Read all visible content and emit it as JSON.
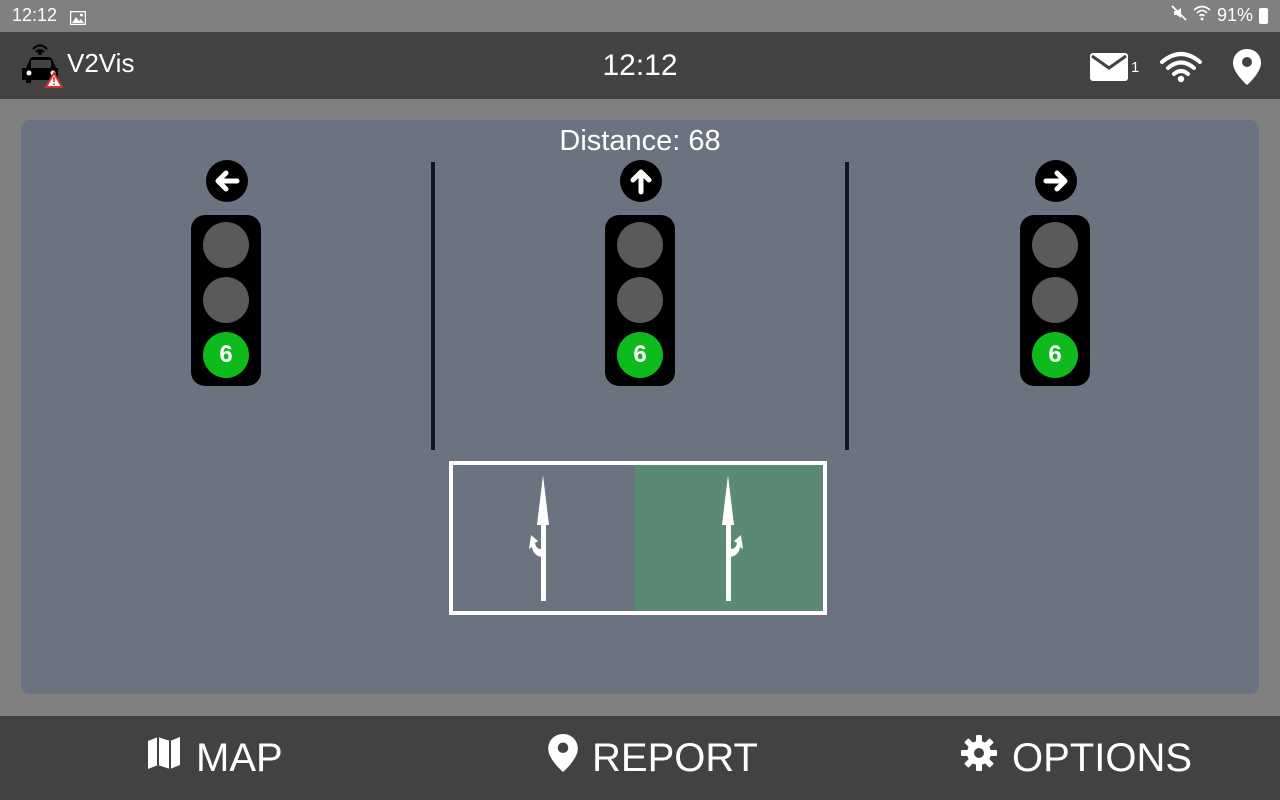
{
  "status_bar": {
    "time": "12:12",
    "battery": "91%"
  },
  "app_bar": {
    "title": "V2Vis",
    "clock": "12:12",
    "message_count": "1"
  },
  "main": {
    "distance_label": "Distance: 68",
    "signals": [
      {
        "direction": "left",
        "countdown": "6",
        "active_light": "green"
      },
      {
        "direction": "straight",
        "countdown": "6",
        "active_light": "green"
      },
      {
        "direction": "right",
        "countdown": "6",
        "active_light": "green"
      }
    ],
    "lanes": [
      {
        "arrows": "straight-left",
        "highlighted": false
      },
      {
        "arrows": "straight-right",
        "highlighted": true
      }
    ]
  },
  "bottom_nav": {
    "map_label": "MAP",
    "report_label": "REPORT",
    "options_label": "OPTIONS"
  },
  "colors": {
    "panel": "#6b7280",
    "green_light": "#0dbb1d",
    "highlight_lane": "#5b8a74",
    "bar": "#424242"
  }
}
